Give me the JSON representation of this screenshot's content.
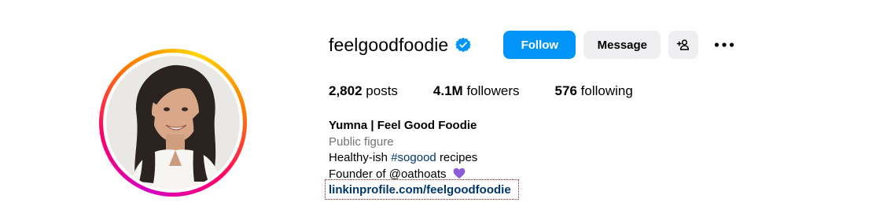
{
  "profile": {
    "username": "feelgoodfoodie",
    "verified_icon": "verified-badge-icon",
    "avatar_icon": "profile-photo",
    "ring_colors": [
      "#d300c5",
      "#ff0069",
      "#ff7a00",
      "#ffd600"
    ]
  },
  "actions": {
    "follow_label": "Follow",
    "message_label": "Message",
    "suggest_icon": "add-person-icon",
    "more_icon": "more-options-icon",
    "follow_color": "#0095f6",
    "secondary_color": "#efeff2"
  },
  "stats": {
    "posts_count": "2,802",
    "posts_label": "posts",
    "followers_count": "4.1M",
    "followers_label": "followers",
    "following_count": "576",
    "following_label": "following"
  },
  "bio": {
    "name": "Yumna | Feel Good Foodie",
    "category": "Public figure",
    "line1_prefix": "Healthy-ish",
    "line1_hashtag": "#sogood",
    "line1_suffix": "recipes",
    "line2_prefix": "Founder of",
    "line2_mention": "@oathoats",
    "line2_emoji": "purple-heart-icon",
    "link": "linkinprofile.com/feelgoodfoodie",
    "link_color": "#00376b",
    "category_color": "#737373"
  }
}
